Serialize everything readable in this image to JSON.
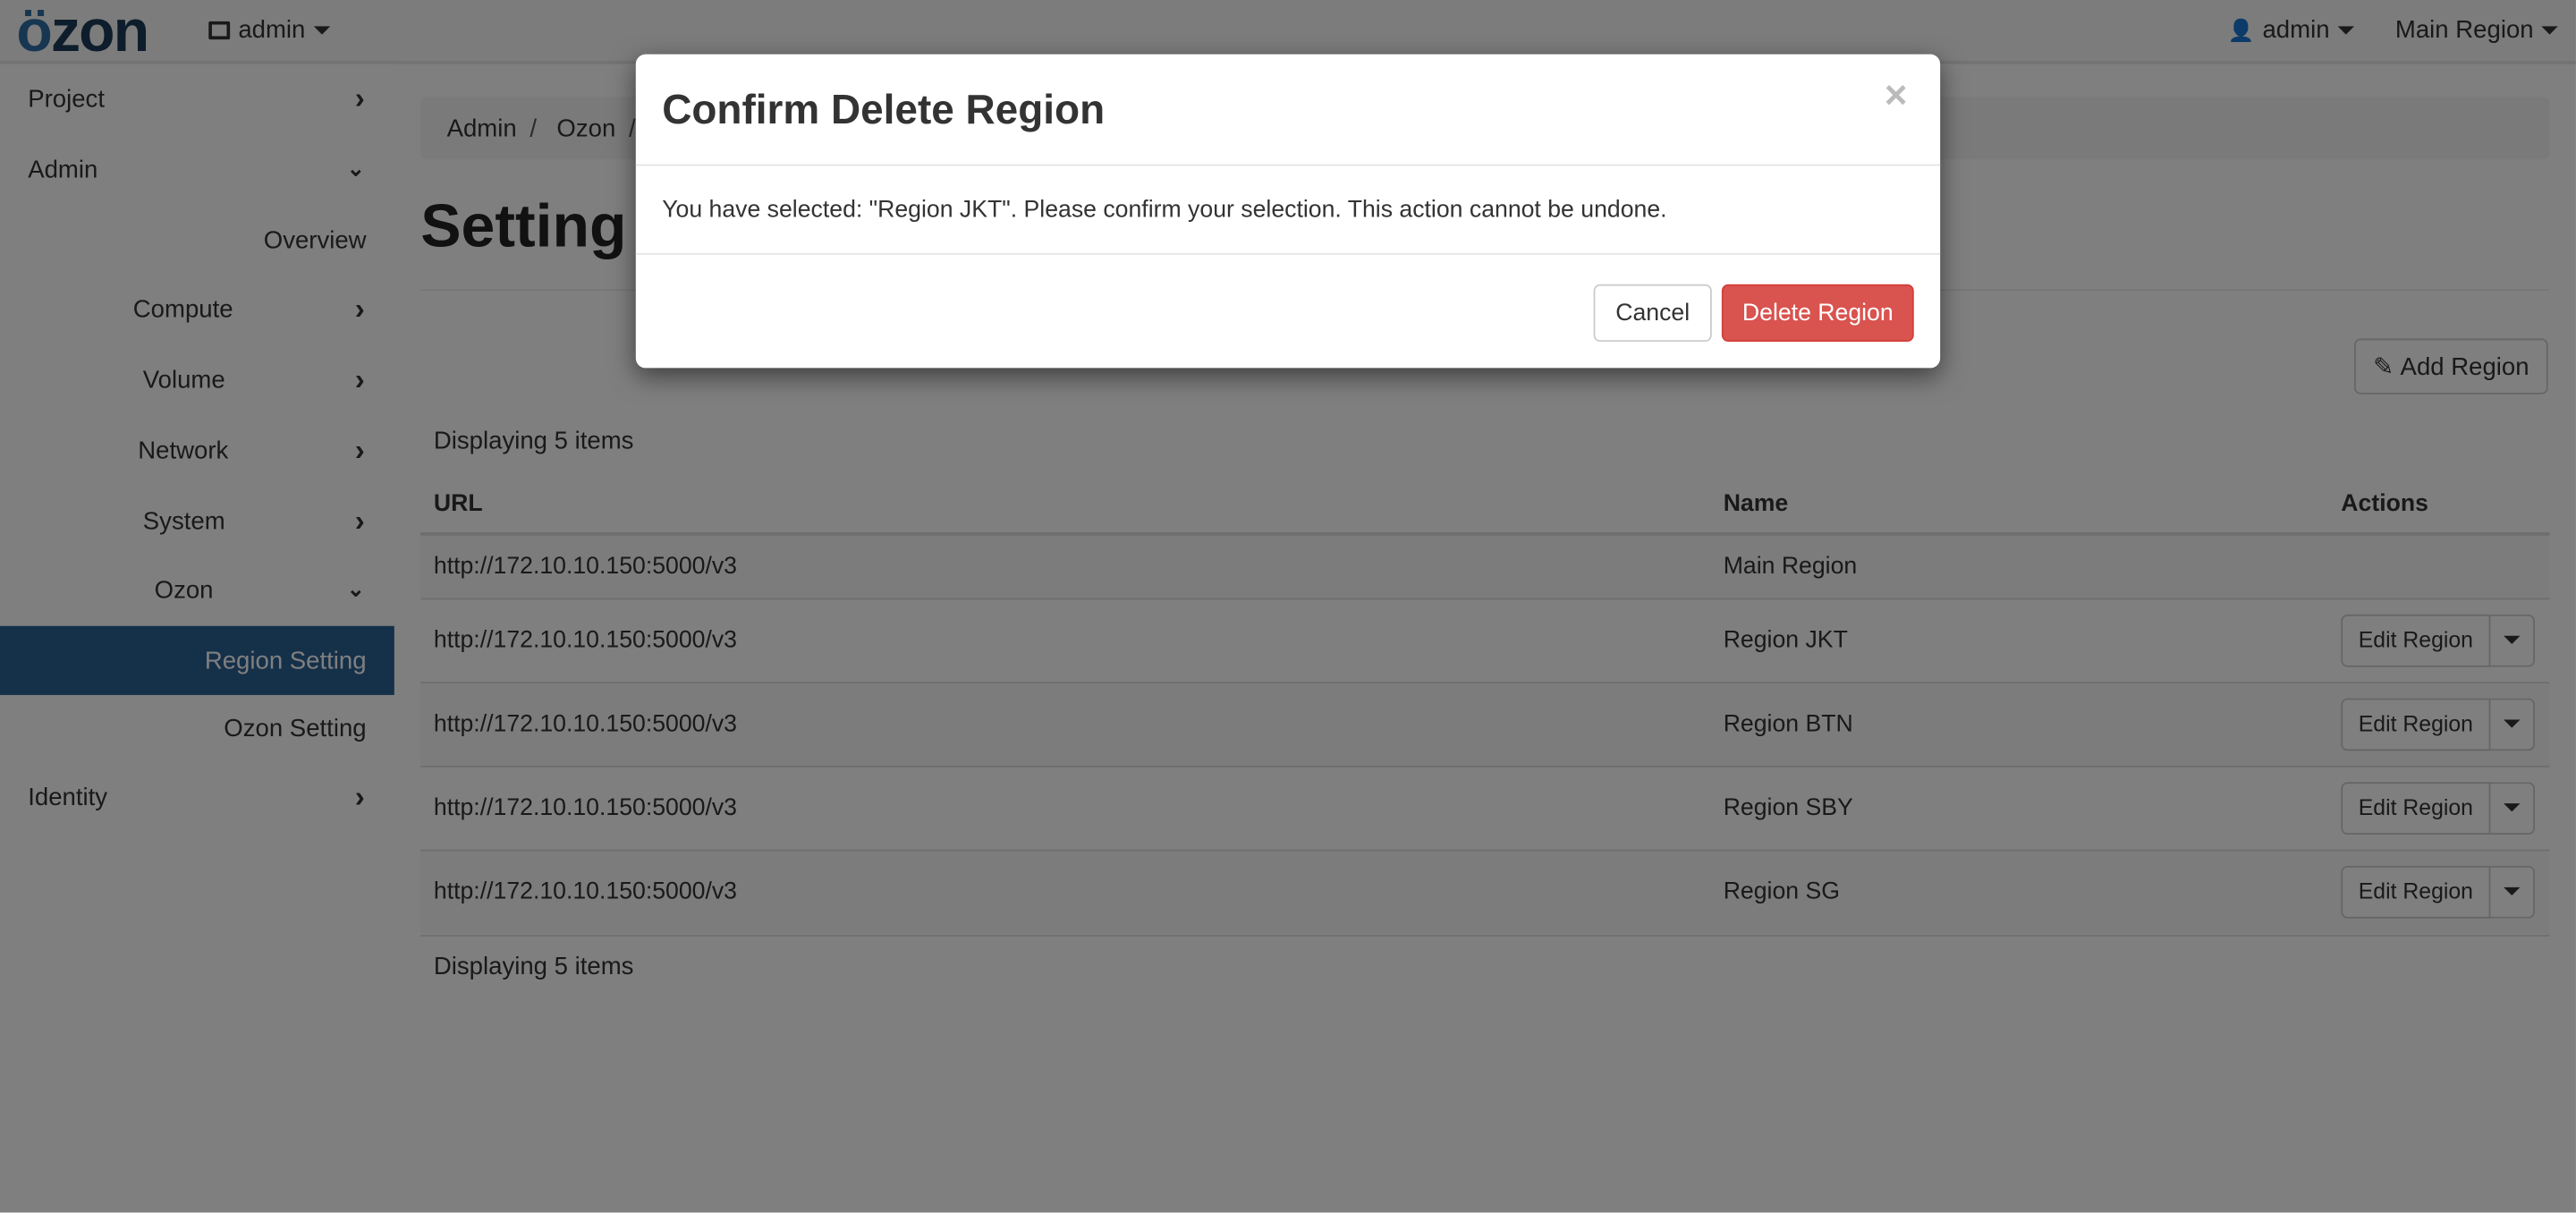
{
  "topbar": {
    "logo": "özon",
    "project_menu": "admin",
    "user_menu": "admin",
    "region_menu": "Main Region"
  },
  "sidebar": {
    "items": [
      {
        "label": "Project",
        "icon": "chevron-right"
      },
      {
        "label": "Admin",
        "icon": "chevron-down"
      },
      {
        "label": "Overview"
      },
      {
        "label": "Compute",
        "icon": "chevron-right"
      },
      {
        "label": "Volume",
        "icon": "chevron-right"
      },
      {
        "label": "Network",
        "icon": "chevron-right"
      },
      {
        "label": "System",
        "icon": "chevron-right"
      },
      {
        "label": "Ozon",
        "icon": "chevron-down"
      },
      {
        "label": "Region Setting",
        "active": true
      },
      {
        "label": "Ozon Setting"
      },
      {
        "label": "Identity",
        "icon": "chevron-right"
      }
    ]
  },
  "breadcrumb": [
    "Admin",
    "Ozon"
  ],
  "page": {
    "title": "Setting",
    "add_button": "Add Region",
    "count_top": "Displaying 5 items",
    "count_bottom": "Displaying 5 items"
  },
  "table": {
    "headers": [
      "URL",
      "Name",
      "Actions"
    ],
    "rows": [
      {
        "url": "http://172.10.10.150:5000/v3",
        "name": "Main Region"
      },
      {
        "url": "http://172.10.10.150:5000/v3",
        "name": "Region JKT",
        "action": "Edit Region"
      },
      {
        "url": "http://172.10.10.150:5000/v3",
        "name": "Region BTN",
        "action": "Edit Region"
      },
      {
        "url": "http://172.10.10.150:5000/v3",
        "name": "Region SBY",
        "action": "Edit Region"
      },
      {
        "url": "http://172.10.10.150:5000/v3",
        "name": "Region SG",
        "action": "Edit Region"
      }
    ]
  },
  "modal": {
    "title": "Confirm Delete Region",
    "close": "×",
    "message": "You have selected: \"Region JKT\". Please confirm your selection. This action cannot be undone.",
    "cancel": "Cancel",
    "confirm": "Delete Region"
  },
  "colors": {
    "danger": "#d9534f",
    "active_nav": "#2a6092",
    "logo": "#1b3a57"
  }
}
